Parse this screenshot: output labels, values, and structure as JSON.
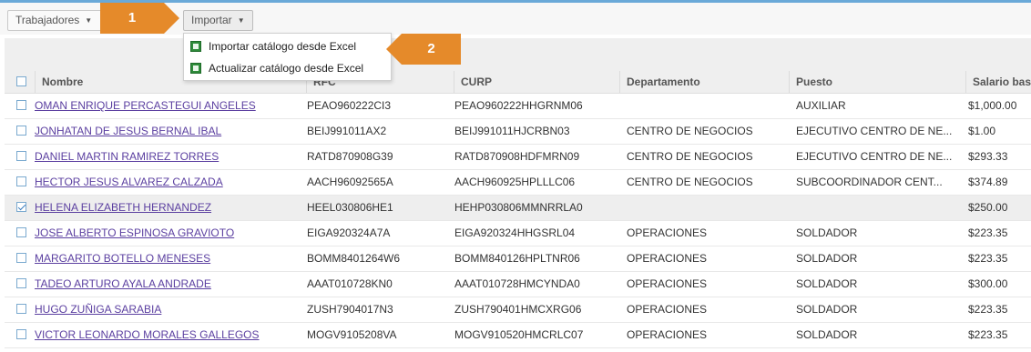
{
  "toolbar": {
    "workers_label": "Trabajadores",
    "import_label": "Importar"
  },
  "import_menu": {
    "items": [
      {
        "label": "Importar catálogo desde Excel",
        "icon": "excel-icon"
      },
      {
        "label": "Actualizar catálogo desde Excel",
        "icon": "excel-icon"
      }
    ]
  },
  "callouts": {
    "step1": "1",
    "step2": "2",
    "color": "#e58a2a"
  },
  "table": {
    "columns": {
      "nombre": "Nombre",
      "rfc": "RFC",
      "curp": "CURP",
      "departamento": "Departamento",
      "puesto": "Puesto",
      "salario": "Salario base"
    },
    "rows": [
      {
        "checked": false,
        "nombre": "OMAN ENRIQUE PERCASTEGUI ANGELES",
        "rfc": "PEAO960222CI3",
        "curp": "PEAO960222HHGRNM06",
        "departamento": "",
        "puesto": "AUXILIAR",
        "salario": "$1,000.00"
      },
      {
        "checked": false,
        "nombre": "JONHATAN DE JESUS BERNAL IBAL",
        "rfc": "BEIJ991011AX2",
        "curp": "BEIJ991011HJCRBN03",
        "departamento": "CENTRO DE NEGOCIOS",
        "puesto": "EJECUTIVO CENTRO DE NE...",
        "salario": "$1.00"
      },
      {
        "checked": false,
        "nombre": "DANIEL MARTIN RAMIREZ TORRES",
        "rfc": "RATD870908G39",
        "curp": "RATD870908HDFMRN09",
        "departamento": "CENTRO DE NEGOCIOS",
        "puesto": "EJECUTIVO CENTRO DE NE...",
        "salario": "$293.33"
      },
      {
        "checked": false,
        "nombre": "HECTOR JESUS ALVAREZ CALZADA",
        "rfc": "AACH96092565A",
        "curp": "AACH960925HPLLLC06",
        "departamento": "CENTRO DE NEGOCIOS",
        "puesto": "SUBCOORDINADOR CENT...",
        "salario": "$374.89"
      },
      {
        "checked": true,
        "nombre": "HELENA ELIZABETH HERNANDEZ",
        "rfc": "HEEL030806HE1",
        "curp": "HEHP030806MMNRRLA0",
        "departamento": "",
        "puesto": "",
        "salario": "$250.00"
      },
      {
        "checked": false,
        "nombre": "JOSE ALBERTO ESPINOSA GRAVIOTO",
        "rfc": "EIGA920324A7A",
        "curp": "EIGA920324HHGSRL04",
        "departamento": "OPERACIONES",
        "puesto": "SOLDADOR",
        "salario": "$223.35"
      },
      {
        "checked": false,
        "nombre": "MARGARITO BOTELLO MENESES",
        "rfc": "BOMM8401264W6",
        "curp": "BOMM840126HPLTNR06",
        "departamento": "OPERACIONES",
        "puesto": "SOLDADOR",
        "salario": "$223.35"
      },
      {
        "checked": false,
        "nombre": "TADEO ARTURO AYALA ANDRADE",
        "rfc": "AAAT010728KN0",
        "curp": "AAAT010728HMCYNDA0",
        "departamento": "OPERACIONES",
        "puesto": "SOLDADOR",
        "salario": "$300.00"
      },
      {
        "checked": false,
        "nombre": "HUGO ZUÑIGA SARABIA",
        "rfc": "ZUSH7904017N3",
        "curp": "ZUSH790401HMCXRG06",
        "departamento": "OPERACIONES",
        "puesto": "SOLDADOR",
        "salario": "$223.35"
      },
      {
        "checked": false,
        "nombre": "VICTOR LEONARDO MORALES GALLEGOS",
        "rfc": "MOGV9105208VA",
        "curp": "MOGV910520HMCRLC07",
        "departamento": "OPERACIONES",
        "puesto": "SOLDADOR",
        "salario": "$223.35"
      }
    ]
  }
}
